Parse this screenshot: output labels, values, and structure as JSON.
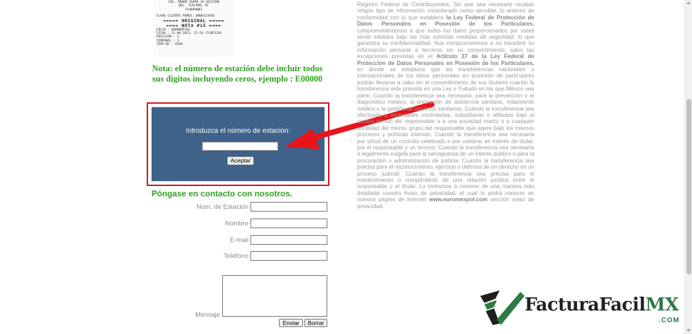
{
  "receipt": {
    "lines_top": [
      "COL. PRADO COAPA 2A SECCION",
      "DEL. TLALPAN, DF",
      "554094003"
    ],
    "client_line": "CLAVE CLIENTE PEMEX: 0000123456",
    "banner1": "===== ORIGINAL =====",
    "banner2": "==== NOTA #15 ====",
    "folio": "FOLIO    : 0000005161",
    "fecha": "FECHA    : 21-08-2013, 12:54 (5185120)",
    "posicion": "POSICION : 1",
    "terminal": "TERMINAL : 1",
    "tipo": "TIPO DE : PEAR"
  },
  "note": {
    "line1": "Nota: el número de estación debe incluir todos",
    "line2": "sus dígitos incluyendo ceros, ejemplo : E00000"
  },
  "station_form": {
    "label": "Introduzca el número de estación:",
    "input_value": "",
    "submit_label": "Aceptar"
  },
  "contact": {
    "title": "Póngase en contacto con nosotros.",
    "fields": {
      "station_label": "Num. de Estación",
      "name_label": "Nombre",
      "email_label": "E-mail",
      "phone_label": "Teléfono",
      "message_label": "Mensaje"
    },
    "send_label": "Enviar",
    "clear_label": "Borrar"
  },
  "privacy": {
    "p1": "Registro Federal de Contribuyentes; Sin que sea necesario recabar ningún tipo de información considerado como sensible, lo anterior de conformidad con lo que establece ",
    "b1": "la Ley Federal de Protección de Datos Personales en Posesión de los Particulares,",
    "p2": " comprometiéndonos a que todos los datos proporcionados por usted serán tratados bajo las más estrictas medidas de seguridad, lo que garantiza su confidencialidad. Nos comprometemos a no transferir su información personal a terceros sin su consentimiento, salvo las excepciones previstas en el ",
    "b2": "Artículo 37 de la Ley Federal de Protección de Datos Personales en Posesión de los Particulares,",
    "p3": " en donde se establece que las transferencias nacionales o internacionales de los datos personales en posesión de particulares podrán llevarse a cabo sin el consentimiento de sus titulares cuando la transferencia este prevista en una Ley o Tratado en los que México sea parte; Cuando la transferencia sea necesaria, para la prevención y el diagnóstico médico, la prestación de asistencia sanitaria, tratamiento médico o la gestión de servicios sanitarios; Cuando la transferencia sea efectuada a sociedades controladas, subsidiarias o afiliadas bajo el control común del responsable o a una sociedad matriz o a cualquier sociedad del mismo grupo del responsable que opere bajo los mismos procesos y políticas internas; Cuando la transferencia sea necesaria por virtud de un contrato celebrado o por celebrar en interés de titular, por el responsable y un tercero; Cuando la transferencia sea necesaria o legalmente exigida para la salvaguarda de un interés público o para la procuración o administración de justicia; Cuando la transferencia sea precisa para el reconocimiento, ejercicio o defensa de un derecho en un proceso judicial; Cuando la transferencia sea precisa para el mantenimiento o cumplimiento de una relación jurídica entre el responsable y el titular. Lo invitamos a conocer de una manera más detallada nuestro Aviso de privacidad, el cual lo podrá conocer en nuestra página de Internet ",
    "b3": "www.euromexpol.com",
    "p4": " sección aviso de privacidad."
  },
  "logo": {
    "name_main": "FacturaFacil",
    "name_accent": "MX",
    "suffix": ".COM"
  },
  "colors": {
    "note_green": "#2ea31e",
    "panel_blue": "#3f628b",
    "highlight_red": "#d0161b",
    "logo_green": "#2f7a45"
  },
  "icons": {
    "arrow": "red-arrow-icon",
    "logo_mark": "check-stripes-logo-icon"
  }
}
